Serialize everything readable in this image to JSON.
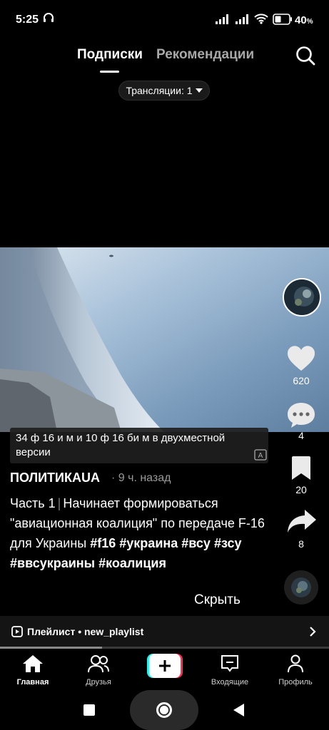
{
  "status_bar": {
    "time": "5:25",
    "battery": "40",
    "battery_unit": "%"
  },
  "top_tabs": {
    "following": "Подписки",
    "for_you": "Рекомендации",
    "active": "following"
  },
  "live": {
    "label": "Трансляции: 1"
  },
  "video": {
    "caption": "34 ф 16 и м и 10 ф 16 би м в двухместной версии"
  },
  "actions": {
    "likes": "620",
    "comments": "4",
    "saves": "20",
    "shares": "8"
  },
  "post": {
    "author": "ПОЛИТИКАUA",
    "time": "· 9 ч. назад",
    "part": "Часть 1",
    "separator": "|",
    "text": "Начинает формироваться \"авиационная коалиция\" по передаче F-16 для Украины",
    "hashtags": [
      "#f16",
      "#украина",
      "#всу",
      "#зсу",
      "#ввсукраины",
      "#коалиция"
    ],
    "hide_label": "Скрыть"
  },
  "playlist": {
    "label": "Плейлист • new_playlist"
  },
  "progress": {
    "fraction": 0.31
  },
  "bottom_nav": {
    "home": "Главная",
    "friends": "Друзья",
    "inbox": "Входящие",
    "profile": "Профиль"
  },
  "colors": {
    "create_cyan": "#25f4ee",
    "create_red": "#fe2c55",
    "inactive_tab": "#a8a8a8",
    "meta_gray": "#9a9a9a"
  }
}
